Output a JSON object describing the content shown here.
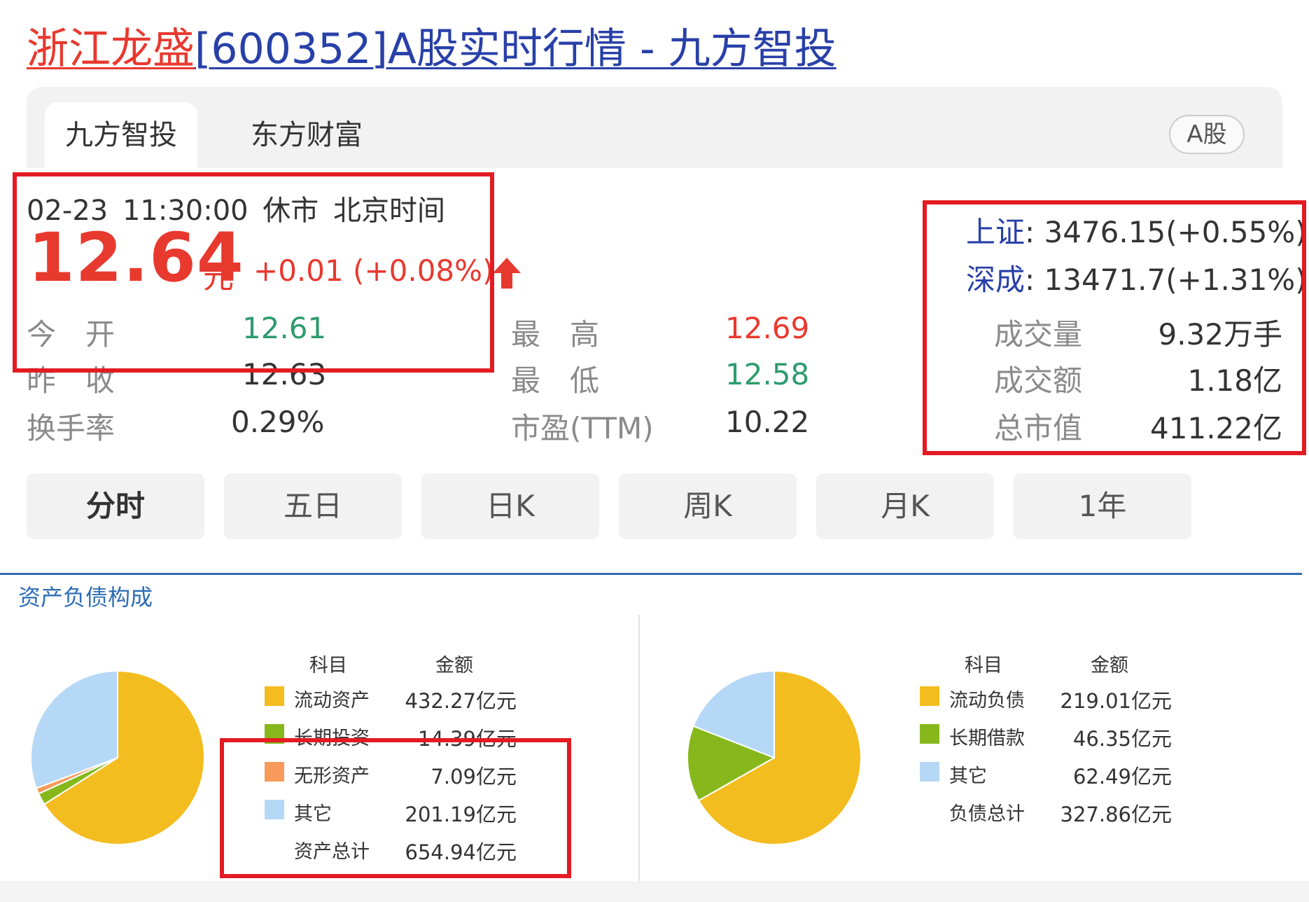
{
  "title": {
    "stock_name": "浙江龙盛",
    "rest": "[600352]A股实时行情 - 九方智投"
  },
  "tabs": {
    "active": "九方智投",
    "inactive": "东方财富",
    "badge": "A股"
  },
  "quote": {
    "datetime": "02-23 11:30:00  休市  北京时间",
    "price": "12.64",
    "unit": "元",
    "change": "+0.01 (+0.08%)",
    "stats": {
      "open_label": "今　开",
      "open": "12.61",
      "prev_label": "昨　收",
      "prev": "12.63",
      "turnover_label": "换手率",
      "turnover": "0.29%",
      "high_label": "最　高",
      "high": "12.69",
      "low_label": "最　低",
      "low": "12.58",
      "pe_label": "市盈(TTM)",
      "pe": "10.22"
    }
  },
  "indices": {
    "sh_name": "上证",
    "sh_value": ": 3476.15(+0.55%)",
    "sz_name": "深成",
    "sz_value": ": 13471.7(+1.31%)",
    "volume_label": "成交量",
    "volume": "9.32万手",
    "amount_label": "成交额",
    "amount": "1.18亿",
    "cap_label": "总市值",
    "cap": "411.22亿"
  },
  "periods": [
    "分时",
    "五日",
    "日K",
    "周K",
    "月K",
    "1年"
  ],
  "balance": {
    "section_title": "资产负债构成",
    "col_item": "科目",
    "col_amount": "金额",
    "assets": {
      "rows": [
        {
          "name": "流动资产",
          "amount": "432.27亿元"
        },
        {
          "name": "长期投资",
          "amount": "14.39亿元"
        },
        {
          "name": "无形资产",
          "amount": "7.09亿元"
        },
        {
          "name": "其它",
          "amount": "201.19亿元"
        }
      ],
      "total_label": "资产总计",
      "total": "654.94亿元"
    },
    "liabilities": {
      "rows": [
        {
          "name": "流动负债",
          "amount": "219.01亿元"
        },
        {
          "name": "长期借款",
          "amount": "46.35亿元"
        },
        {
          "name": "其它",
          "amount": "62.49亿元"
        }
      ],
      "total_label": "负债总计",
      "total": "327.86亿元"
    }
  },
  "chart_data": [
    {
      "type": "pie",
      "categories": [
        "流动资产",
        "长期投资",
        "无形资产",
        "其它"
      ],
      "values": [
        432.27,
        14.39,
        7.09,
        201.19
      ],
      "colors": [
        "#f3bd1f",
        "#86b81b",
        "#f79a5a",
        "#b5d8f6"
      ]
    },
    {
      "type": "pie",
      "categories": [
        "流动负债",
        "长期借款",
        "其它"
      ],
      "values": [
        219.01,
        46.35,
        62.49
      ],
      "colors": [
        "#f3bd1f",
        "#86b81b",
        "#b5d8f6"
      ]
    }
  ],
  "colors": {
    "up": "#e8392f",
    "down": "#2e9b6e",
    "link": "#2840a8",
    "highlight_box": "#e31b23"
  }
}
